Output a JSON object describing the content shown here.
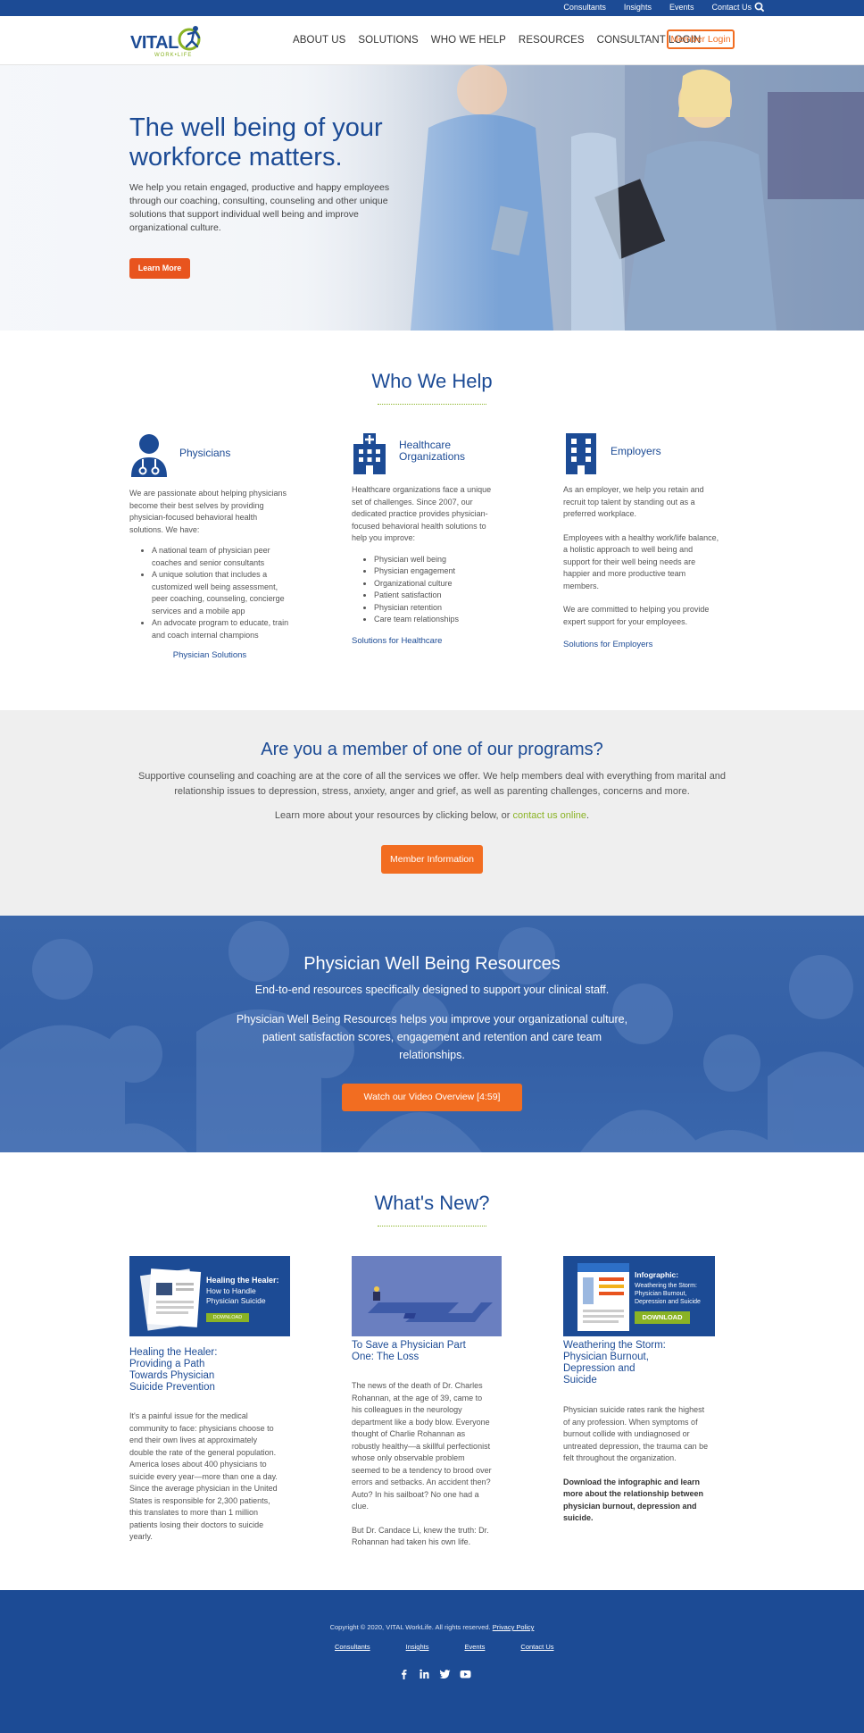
{
  "utility_bar": {
    "links": [
      "Consultants",
      "Insights",
      "Events",
      "Contact Us"
    ],
    "search_icon": "search-icon"
  },
  "brand": {
    "name": "VITAL",
    "tagline": "WORK•LIFE",
    "primary_color": "#1c4b95",
    "accent_color": "#f26d21",
    "green_color": "#8ab325"
  },
  "nav": {
    "items": [
      "ABOUT US",
      "SOLUTIONS",
      "WHO WE HELP",
      "RESOURCES",
      "CONSULTANT LOGIN"
    ],
    "member_login": "Member Login"
  },
  "hero": {
    "title": "The well being of your workforce matters.",
    "body": "We help you retain engaged, productive and happy employees through our coaching, consulting, counseling and other unique solutions that support individual well being and improve organizational culture.",
    "button": "Learn More"
  },
  "who_we_help": {
    "title": "Who We Help",
    "physicians": {
      "heading": "Physicians",
      "icon": "physician-icon",
      "intro": "We are passionate about helping physicians become their best selves by providing physician-focused behavioral health solutions. We have:",
      "bullets": [
        "A national team of physician peer coaches and senior consultants",
        "A unique solution that includes a customized well being assessment, peer coaching, counseling, concierge services and a mobile app",
        "An advocate program to educate, train and coach internal champions"
      ],
      "link": "Physician Solutions"
    },
    "healthcare": {
      "heading": "Healthcare Organizations",
      "icon": "hospital-icon",
      "intro": "Healthcare organizations face a unique set of challenges. Since 2007, our dedicated practice provides physician-focused behavioral health solutions to help you improve:",
      "bullets": [
        "Physician well being",
        "Physician engagement",
        "Organizational culture",
        "Patient satisfaction",
        "Physician retention",
        "Care team relationships"
      ],
      "link": "Solutions for Healthcare"
    },
    "employers": {
      "heading": "Employers",
      "icon": "office-building-icon",
      "p1": "As an employer, we help you retain and recruit top talent by standing out as a preferred workplace.",
      "p2": "Employees with a healthy work/life balance, a holistic approach to well being and support for their well being needs are happier and more productive team members.",
      "p3": "We are committed to helping you provide expert support for your employees.",
      "link": "Solutions for Employers"
    }
  },
  "members": {
    "title": "Are you a member of one of our programs?",
    "body": "Supportive counseling and coaching are at the core of all the services we offer. We help members deal with everything from marital and relationship issues to depression, stress, anxiety, anger and grief, as well as parenting challenges, concerns and more.",
    "learn_prefix": "Learn more about your resources by clicking below, or",
    "learn_link": "contact us online",
    "learn_suffix": ".",
    "button": "Member Information"
  },
  "pwb": {
    "title": "Physician Well Being Resources",
    "subtitle": "End-to-end resources specifically designed to support your clinical staff.",
    "body": "Physician Well Being Resources helps you improve your organizational culture, patient satisfaction scores, engagement and retention and care team relationships.",
    "button": "Watch our Video Overview [4:59]"
  },
  "whats_new": {
    "title": "What's New?",
    "articles": [
      {
        "thumb_heading": "Healing the Healer:",
        "thumb_sub": "How to Handle Physician Suicide",
        "thumb_button": "DOWNLOAD",
        "title": "Healing the Healer: Providing a Path Towards Physician Suicide Prevention",
        "body": "It's a painful issue for the medical community to face: physicians choose to end their own lives at approximately double the rate of the general population. America loses about 400 physicians to suicide every year—more than one a day. Since the average physician in the United States is responsible for 2,300 patients, this translates to more than 1 million patients losing their doctors to suicide yearly."
      },
      {
        "title": "To Save a Physician Part One: The Loss",
        "body": "The news of the death of Dr. Charles Rohannan, at the age of 39, came to his colleagues in the neurology department like a body blow. Everyone thought of Charlie Rohannan as robustly healthy—a skillful perfectionist whose only observable problem seemed to be a tendency to brood over errors and setbacks. An accident then? Auto? In his sailboat? No one had a clue.",
        "body2": "But Dr. Candace Li, knew the truth: Dr. Rohannan had taken his own life."
      },
      {
        "thumb_heading": "Infographic:",
        "thumb_sub": "Weathering the Storm: Physician Burnout, Depression and Suicide",
        "thumb_button": "DOWNLOAD",
        "title": "Weathering the Storm: Physician Burnout, Depression and Suicide",
        "body": "Physician suicide rates rank the highest of any profession. When symptoms of burnout collide with undiagnosed or untreated depression, the trauma can be felt throughout the organization.",
        "body_bold": "Download the infographic and learn more about the relationship between physician burnout, depression and suicide."
      }
    ]
  },
  "footer": {
    "copyright": "Copyright © 2020, VITAL WorkLife. All rights reserved.",
    "privacy": "Privacy Policy",
    "links": [
      "Consultants",
      "Insights",
      "Events",
      "Contact Us"
    ],
    "social": [
      "facebook-icon",
      "linkedin-icon",
      "twitter-icon",
      "youtube-icon"
    ]
  }
}
